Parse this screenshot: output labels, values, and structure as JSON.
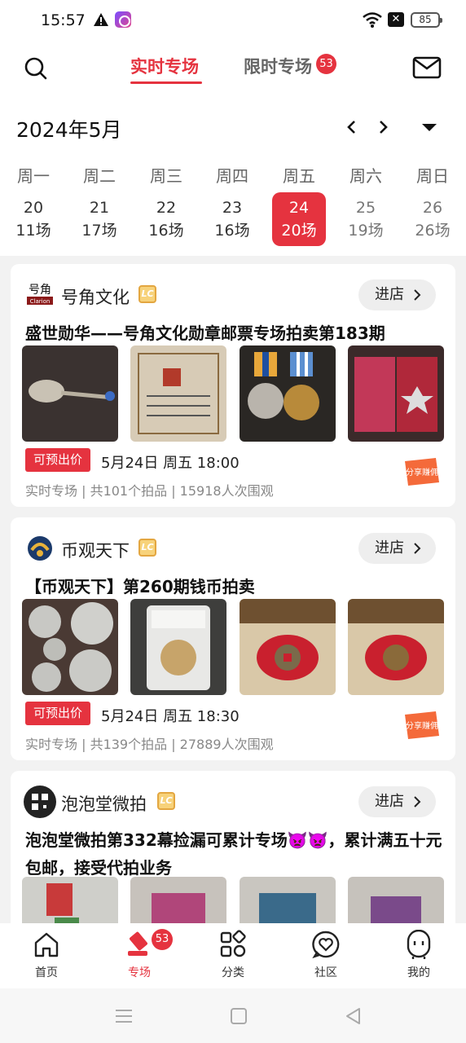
{
  "status_bar": {
    "time": "15:57",
    "battery": "85"
  },
  "header": {
    "tabs": [
      {
        "label": "实时专场",
        "active": true
      },
      {
        "label": "限时专场",
        "badge": "53"
      }
    ]
  },
  "calendar": {
    "month": "2024年5月",
    "weekdays": [
      "周一",
      "周二",
      "周三",
      "周四",
      "周五",
      "周六",
      "周日"
    ],
    "days": [
      {
        "date": "20",
        "count": "11场"
      },
      {
        "date": "21",
        "count": "17场"
      },
      {
        "date": "22",
        "count": "16场"
      },
      {
        "date": "23",
        "count": "16场"
      },
      {
        "date": "24",
        "count": "20场",
        "selected": true
      },
      {
        "date": "25",
        "count": "19场"
      },
      {
        "date": "26",
        "count": "26场"
      }
    ]
  },
  "cards": [
    {
      "shop": "号角文化",
      "badge": "LC",
      "enter": "进店",
      "title": "盛世勋华——号角文化勋章邮票专场拍卖第183期",
      "pre_bid": "可预出价",
      "time": "5月24日 周五 18:00",
      "meta": "实时专场 | 共101个拍品 | 15918人次围观",
      "share": "分享赚佣"
    },
    {
      "shop": "币观天下",
      "badge": "LC",
      "enter": "进店",
      "title": "【币观天下】第260期钱币拍卖",
      "pre_bid": "可预出价",
      "time": "5月24日 周五 18:30",
      "meta": "实时专场 | 共139个拍品 | 27889人次围观",
      "share": "分享赚佣"
    },
    {
      "shop": "泡泡堂微拍",
      "badge": "LC",
      "enter": "进店",
      "title": "泡泡堂微拍第332幕捡漏可累计专场👿👿，累计满五十元包邮，接受代拍业务"
    }
  ],
  "bottom_nav": [
    {
      "label": "首页",
      "icon": "home-icon"
    },
    {
      "label": "专场",
      "icon": "auction-gavel-icon",
      "badge": "53",
      "active": true
    },
    {
      "label": "分类",
      "icon": "category-icon"
    },
    {
      "label": "社区",
      "icon": "community-heart-icon"
    },
    {
      "label": "我的",
      "icon": "profile-icon"
    }
  ],
  "colors": {
    "accent": "#e5333f",
    "background": "#f2f2f2"
  }
}
